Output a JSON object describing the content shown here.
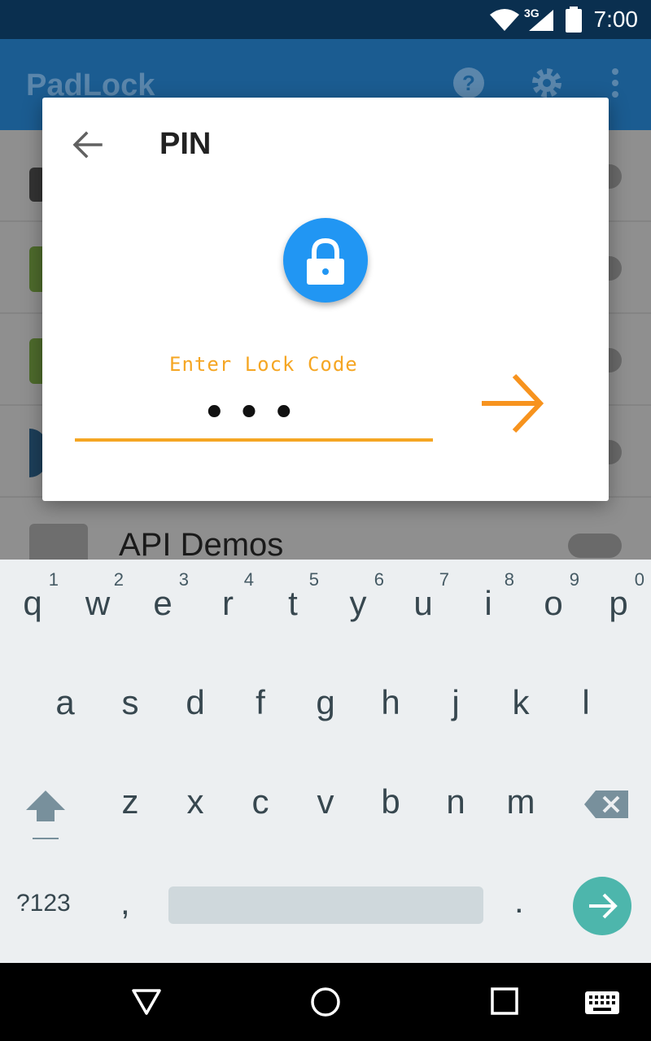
{
  "status_bar": {
    "time": "7:00",
    "network_label": "3G"
  },
  "app_bar": {
    "title": "PadLock",
    "icons": [
      "help-icon",
      "gear-icon",
      "overflow-menu-icon"
    ]
  },
  "list": {
    "visible_item_label": "API Demos"
  },
  "dialog": {
    "title": "PIN",
    "field_label": "Enter Lock Code",
    "pin_value_masked": "•••",
    "colors": {
      "accent": "#f5a623",
      "lock_circle": "#2196f3"
    }
  },
  "keyboard": {
    "row1": [
      {
        "key": "q",
        "hint": "1"
      },
      {
        "key": "w",
        "hint": "2"
      },
      {
        "key": "e",
        "hint": "3"
      },
      {
        "key": "r",
        "hint": "4"
      },
      {
        "key": "t",
        "hint": "5"
      },
      {
        "key": "y",
        "hint": "6"
      },
      {
        "key": "u",
        "hint": "7"
      },
      {
        "key": "i",
        "hint": "8"
      },
      {
        "key": "o",
        "hint": "9"
      },
      {
        "key": "p",
        "hint": "0"
      }
    ],
    "row2": [
      "a",
      "s",
      "d",
      "f",
      "g",
      "h",
      "j",
      "k",
      "l"
    ],
    "row3": [
      "z",
      "x",
      "c",
      "v",
      "b",
      "n",
      "m"
    ],
    "symbols_label": "?123",
    "comma": ",",
    "period": ".",
    "enter_color": "#4db6ac"
  },
  "nav_bar": {
    "buttons": [
      "back-icon",
      "home-icon",
      "recents-icon",
      "keyboard-icon"
    ]
  }
}
